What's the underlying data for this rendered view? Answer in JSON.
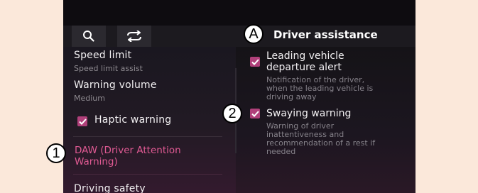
{
  "toolbar": {
    "search_icon": "search-icon",
    "refresh_icon": "swap-arrows-icon"
  },
  "callouts": {
    "a": "A",
    "one": "1",
    "two": "2"
  },
  "header": {
    "title": "Driver assistance"
  },
  "left_menu": {
    "speed_limit": {
      "title": "Speed limit",
      "value": "Speed limit assist"
    },
    "warning_volume": {
      "title": "Warning volume",
      "value": "Medium"
    },
    "haptic_warning": {
      "label": "Haptic warning",
      "checked": true
    },
    "daw": {
      "line1": "DAW (Driver Attention",
      "line2": "Warning)"
    },
    "driving_safety": {
      "title": "Driving safety"
    }
  },
  "right_options": {
    "leading_vehicle": {
      "title_line1": "Leading vehicle",
      "title_line2": "departure alert",
      "desc_line1": "Notification of the driver,",
      "desc_line2": "when the leading vehicle is",
      "desc_line3": "driving away",
      "checked": true
    },
    "swaying": {
      "title": "Swaying warning",
      "desc_line1": "Warning of driver",
      "desc_line2": "inattentiveness and",
      "desc_line3": "recommendation of a rest if",
      "desc_line4": "needed",
      "checked": true
    }
  },
  "colors": {
    "accent": "#b0407a",
    "selected_text": "#e05a93",
    "page_background": "#fbe8da",
    "screen_background": "#141015"
  }
}
